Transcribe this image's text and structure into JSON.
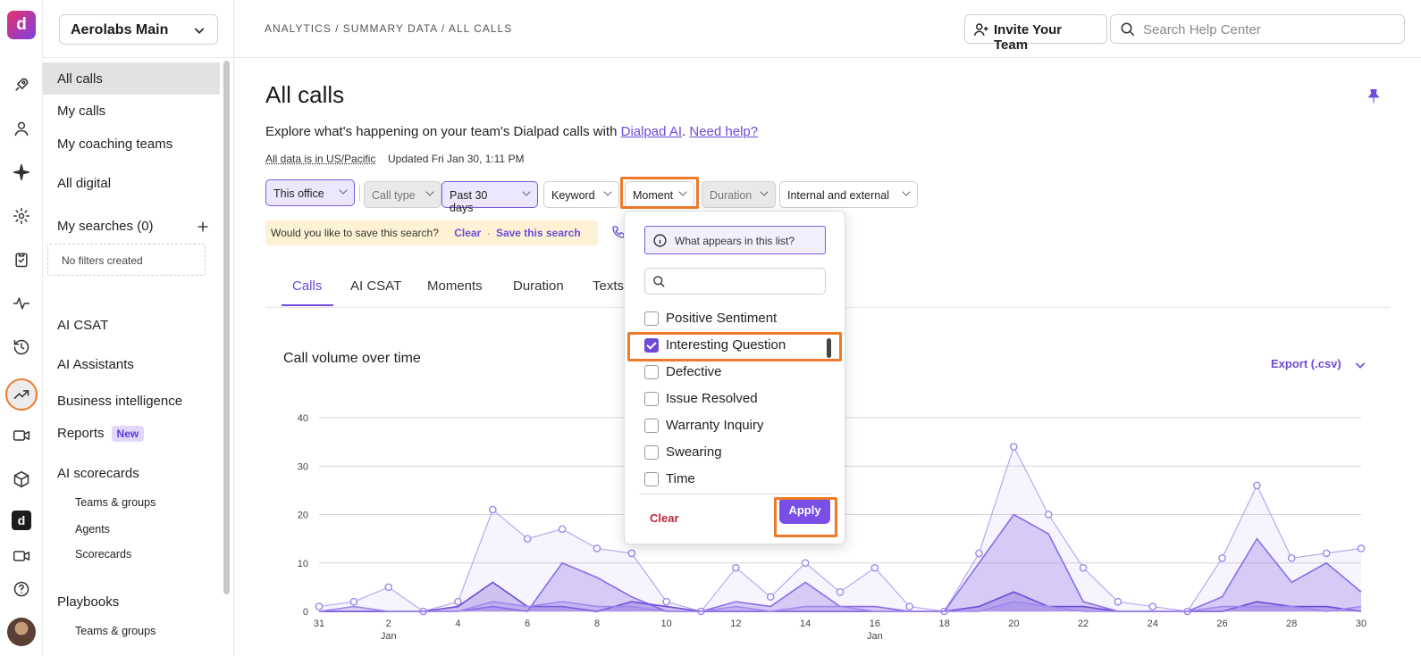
{
  "workspace": "Aerolabs Main",
  "breadcrumb": "ANALYTICS / SUMMARY DATA / ALL CALLS",
  "topbar": {
    "invite_label": "Invite Your Team",
    "search_placeholder": "Search Help Center"
  },
  "rail": {
    "icons": [
      "dialpad-logo-icon",
      "rocket-icon",
      "person-icon",
      "sparkle-icon",
      "gear-icon",
      "clipboard-icon",
      "activity-icon",
      "history-icon",
      "trending-up-icon",
      "video-camera-icon",
      "cube-icon",
      "dialpad-d-icon",
      "video-icon",
      "help-icon",
      "avatar"
    ]
  },
  "sidebar": {
    "all_calls": "All calls",
    "my_calls": "My calls",
    "my_coaching_teams": "My coaching teams",
    "all_digital": "All digital",
    "my_searches": "My searches (0)",
    "no_filters": "No filters created",
    "ai_csat": "AI CSAT",
    "ai_assistants": "AI Assistants",
    "business_intelligence": "Business intelligence",
    "reports": "Reports",
    "reports_badge": "New",
    "ai_scorecards": "AI scorecards",
    "teams_groups": "Teams & groups",
    "agents": "Agents",
    "scorecards": "Scorecards",
    "playbooks": "Playbooks",
    "playbooks_teams_groups": "Teams & groups"
  },
  "main": {
    "title": "All calls",
    "intro_text": "Explore what's happening on your team's Dialpad calls with ",
    "intro_link1": "Dialpad AI",
    "intro_sep": ". ",
    "intro_link2": "Need help?",
    "timezone": "All data is in US/Pacific",
    "updated": "Updated Fri Jan 30, 1:11 PM"
  },
  "filters": {
    "this_office": "This office",
    "call_type": "Call type",
    "past_30_days": "Past 30 days",
    "keyword": "Keyword",
    "moment": "Moment",
    "duration": "Duration",
    "internal_external": "Internal and external"
  },
  "save_banner": {
    "question": "Would you like to save this search?",
    "clear": "Clear",
    "dot": "·",
    "save": "Save this search"
  },
  "tabs": [
    "Calls",
    "AI CSAT",
    "Moments",
    "Duration",
    "Texts"
  ],
  "chart_header": {
    "title": "Call volume over time",
    "export": "Export (.csv)"
  },
  "dropdown": {
    "info": "What appears in this list?",
    "options": [
      {
        "label": "Positive Sentiment",
        "checked": false
      },
      {
        "label": "Interesting Question",
        "checked": true
      },
      {
        "label": "Defective",
        "checked": false
      },
      {
        "label": "Issue Resolved",
        "checked": false
      },
      {
        "label": "Warranty Inquiry",
        "checked": false
      },
      {
        "label": "Swearing",
        "checked": false
      },
      {
        "label": "Time",
        "checked": false
      }
    ],
    "clear": "Clear",
    "apply": "Apply"
  },
  "colors": {
    "accent": "#6d4bd6",
    "highlight": "#ee7a2a",
    "clear_red": "#c0263d"
  },
  "chart_data": {
    "type": "area",
    "x": [
      "Dec 31",
      "Jan 1",
      "Jan 2",
      "Jan 3",
      "Jan 4",
      "Jan 5",
      "Jan 6",
      "Jan 7",
      "Jan 8",
      "Jan 9",
      "Jan 10",
      "Jan 11",
      "Jan 12",
      "Jan 13",
      "Jan 14",
      "Jan 15",
      "Jan 16",
      "Jan 17",
      "Jan 18",
      "Jan 19",
      "Jan 20",
      "Jan 21",
      "Jan 22",
      "Jan 23",
      "Jan 24",
      "Jan 25",
      "Jan 26",
      "Jan 27",
      "Jan 28",
      "Jan 29",
      "Jan 30"
    ],
    "x_tick_labels": [
      "31",
      "2",
      "4",
      "6",
      "8",
      "10",
      "12",
      "14",
      "16",
      "18",
      "20",
      "22",
      "24",
      "26",
      "28",
      "30"
    ],
    "x_month_labels": [
      {
        "at": "Jan 2",
        "label": "Jan"
      },
      {
        "at": "Jan 16",
        "label": "Jan"
      }
    ],
    "y_ticks": [
      0,
      10,
      20,
      30,
      40
    ],
    "ylim": [
      0,
      40
    ],
    "series": [
      {
        "values": [
          1,
          2,
          5,
          0,
          2,
          21,
          15,
          17,
          13,
          12,
          2,
          0,
          9,
          3,
          10,
          4,
          9,
          1,
          0,
          12,
          34,
          20,
          9,
          2,
          1,
          0,
          11,
          26,
          11,
          12,
          13
        ],
        "markers": true,
        "color": "#b8a8f0"
      },
      {
        "values": [
          0,
          0,
          0,
          0,
          0,
          1,
          0,
          10,
          7,
          3,
          0,
          0,
          2,
          1,
          6,
          1,
          1,
          0,
          0,
          10,
          20,
          16,
          2,
          0,
          0,
          0,
          3,
          15,
          6,
          10,
          4
        ],
        "color": "#8a6de8"
      },
      {
        "values": [
          0,
          0,
          0,
          0,
          1,
          6,
          1,
          1,
          0,
          2,
          1,
          0,
          0,
          0,
          0,
          0,
          0,
          0,
          0,
          1,
          4,
          1,
          1,
          0,
          0,
          0,
          0,
          2,
          1,
          1,
          0
        ],
        "color": "#6d4bd6"
      },
      {
        "values": [
          0,
          1,
          0,
          0,
          0,
          2,
          1,
          2,
          1,
          1,
          0,
          0,
          1,
          0,
          1,
          1,
          0,
          0,
          0,
          0,
          2,
          1,
          0,
          0,
          0,
          0,
          1,
          1,
          1,
          0,
          1
        ],
        "color": "#9f87ec"
      }
    ]
  }
}
